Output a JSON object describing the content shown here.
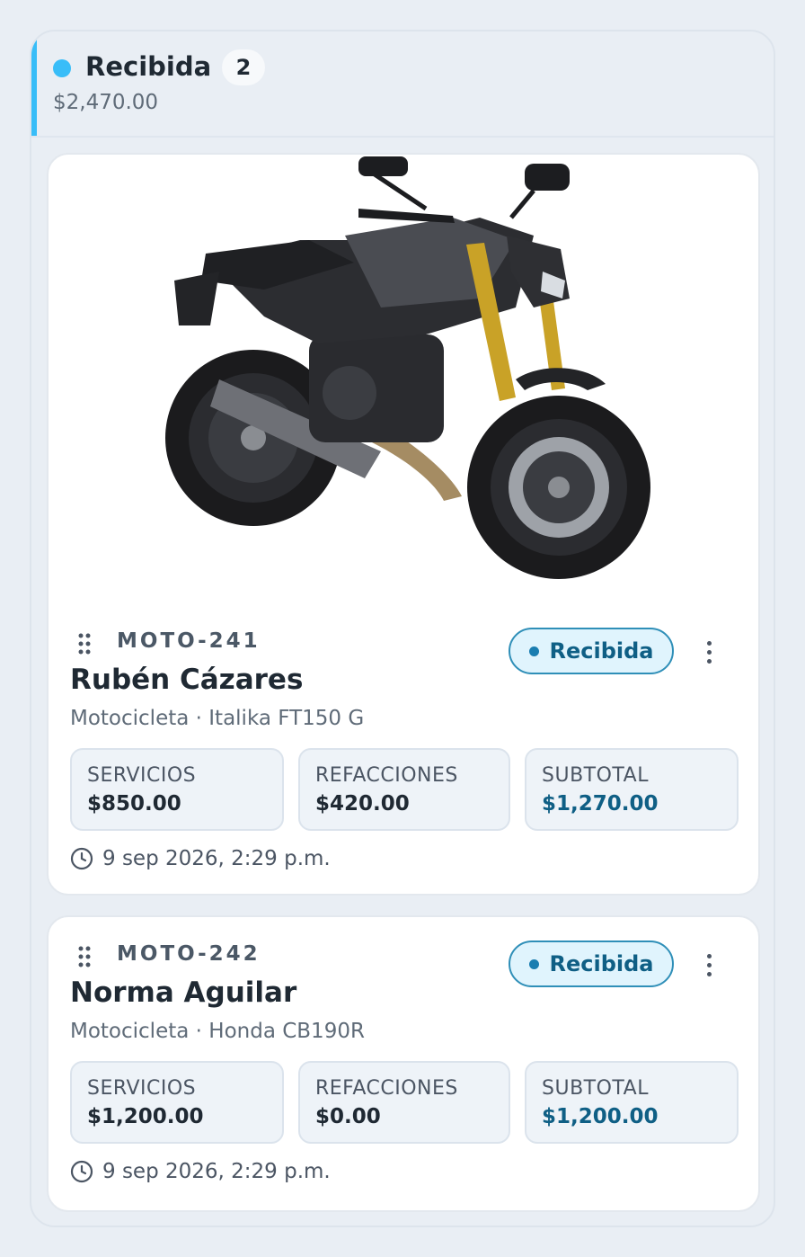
{
  "column": {
    "title": "Recibida",
    "count": "2",
    "total": "$2,470.00",
    "accent_color": "#38bdf8"
  },
  "cards": [
    {
      "code": "MOTO-241",
      "customer": "Rubén Cázares",
      "vehicle": "Motocicleta · Italika FT150 G",
      "status": "Recibida",
      "has_photo": true,
      "photo_alt_icon": "motorcycle-photo",
      "stats": [
        {
          "label": "SERVICIOS",
          "value": "$850.00"
        },
        {
          "label": "REFACCIONES",
          "value": "$420.00"
        },
        {
          "label": "SUBTOTAL",
          "value": "$1,270.00"
        }
      ],
      "timestamp": "9 sep 2026, 2:29 p.m."
    },
    {
      "code": "MOTO-242",
      "customer": "Norma Aguilar",
      "vehicle": "Motocicleta · Honda CB190R",
      "status": "Recibida",
      "has_photo": false,
      "stats": [
        {
          "label": "SERVICIOS",
          "value": "$1,200.00"
        },
        {
          "label": "REFACCIONES",
          "value": "$0.00"
        },
        {
          "label": "SUBTOTAL",
          "value": "$1,200.00"
        }
      ],
      "timestamp": "9 sep 2026, 2:29 p.m."
    }
  ],
  "icons": {
    "drag": "drag-handle-icon",
    "menu": "more-vertical-icon",
    "clock": "clock-icon"
  },
  "colors": {
    "status_pill_bg": "#e0f4fd",
    "status_pill_border": "#2f8fb8",
    "subtotal_value": "#0f5f85"
  }
}
